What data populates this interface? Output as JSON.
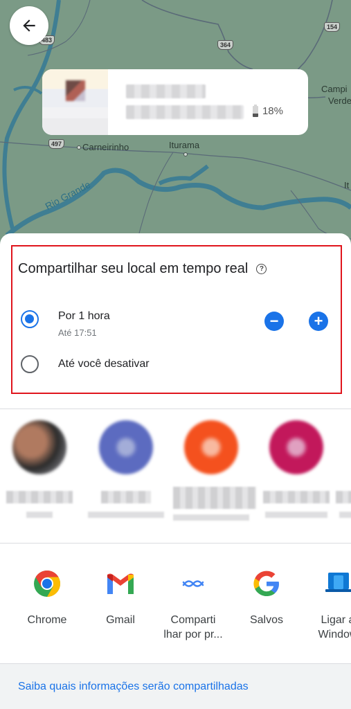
{
  "map": {
    "labels": {
      "carneirinho": "Carneirinho",
      "iturama": "Iturama",
      "campina_verde_line1": "Campi",
      "campina_verde_line2": "Verde",
      "it_partial": "It",
      "rio_grande": "Rio Grande"
    },
    "route_badges": [
      "483",
      "364",
      "154",
      "497"
    ],
    "back_icon": "arrow-left-icon"
  },
  "person_card": {
    "name": "",
    "status": "",
    "battery_percent": "18%",
    "battery_level": 0.18,
    "battery_icon": "battery-low-icon"
  },
  "sheet": {
    "title": "Compartilhar seu local em tempo real",
    "help_icon": "help-circle-icon",
    "options": [
      {
        "label": "Por 1 hora",
        "sublabel": "Até 17:51",
        "selected": true
      },
      {
        "label": "Até você desativar",
        "sublabel": "",
        "selected": false
      }
    ],
    "decrease_icon": "minus-circle-icon",
    "increase_icon": "plus-circle-icon",
    "highlight_color": "#e0141c",
    "accent_color": "#1a73e8"
  },
  "contacts": [
    {
      "avatar_color": "#7a5a4a"
    },
    {
      "avatar_color": "#5c6bc0"
    },
    {
      "avatar_color": "#f4511e"
    },
    {
      "avatar_color": "#c2185b"
    }
  ],
  "apps": [
    {
      "label": "Chrome",
      "icon": "chrome-icon"
    },
    {
      "label": "Gmail",
      "icon": "gmail-icon"
    },
    {
      "label": "Comparti\nlhar por pr...",
      "icon": "nearby-share-icon"
    },
    {
      "label": "Salvos",
      "icon": "google-icon"
    },
    {
      "label": "Ligar a\nWindow",
      "icon": "link-to-windows-icon"
    }
  ],
  "footer": {
    "link": "Saiba quais informações serão compartilhadas"
  }
}
